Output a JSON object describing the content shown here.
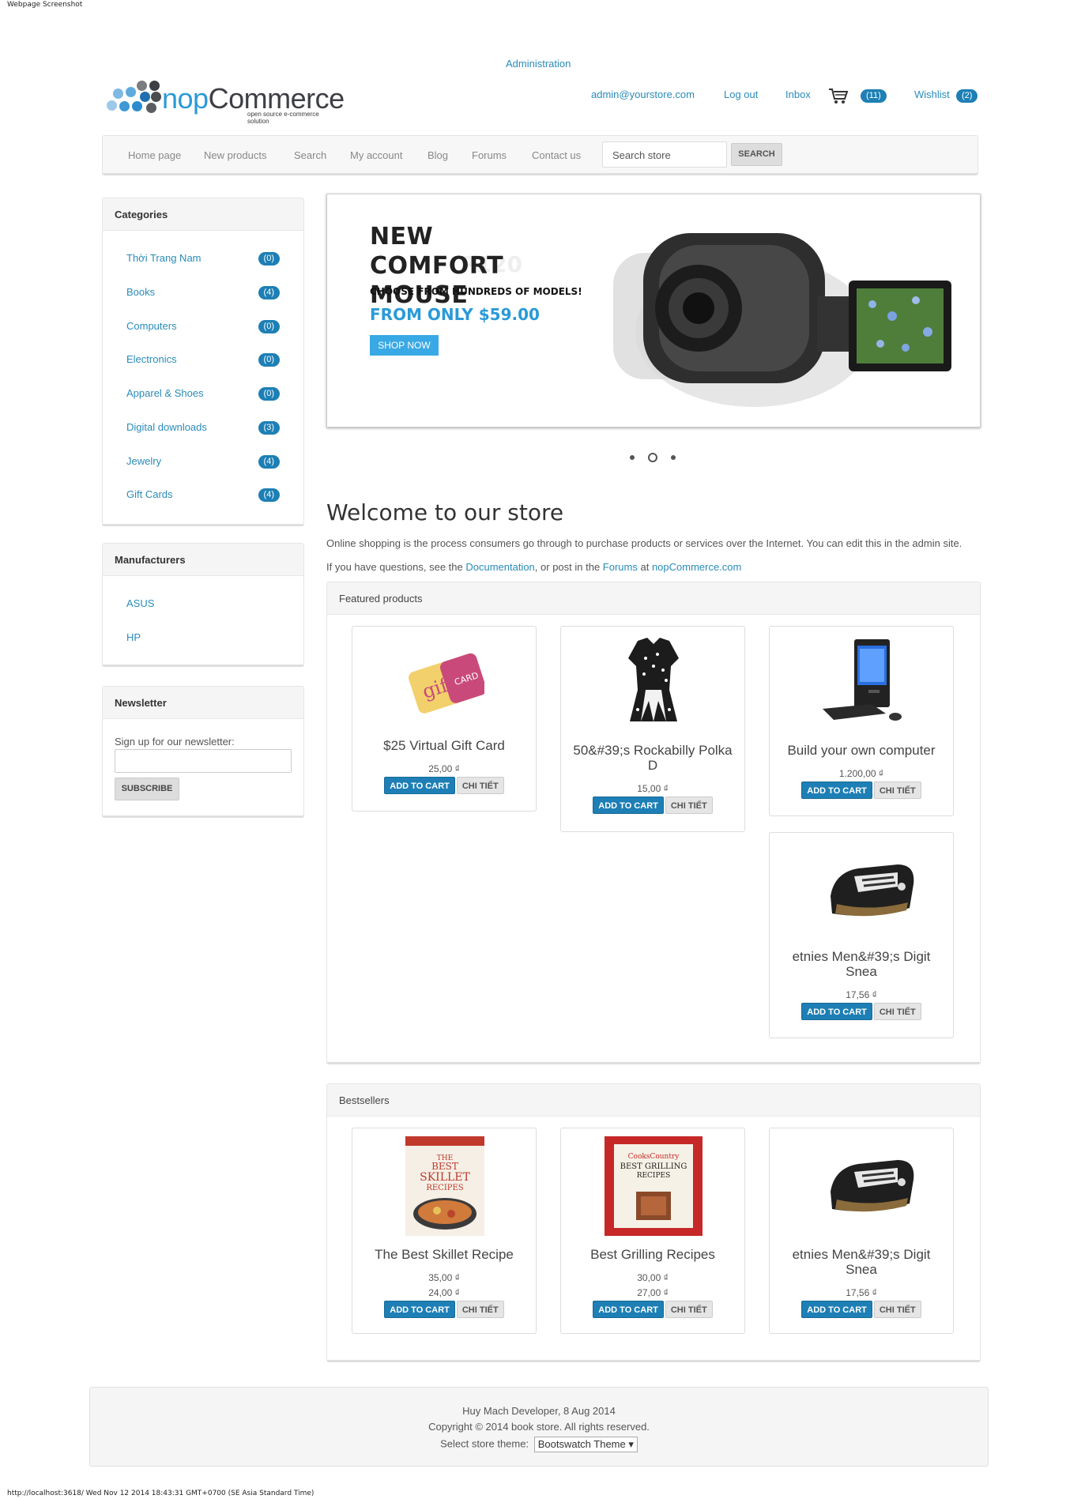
{
  "captions": {
    "top": "Webpage Screenshot",
    "bottom": "http://localhost:3618/ Wed Nov 12 2014 18:43:31 GMT+0700 (SE Asia Standard Time)"
  },
  "header": {
    "admin_link": "Administration",
    "logo_text_a": "nop",
    "logo_text_b": "Commerce",
    "logo_tagline": "open source e-commerce solution",
    "account": "admin@yourstore.com",
    "logout": "Log out",
    "inbox": "Inbox",
    "cart_count": "(11)",
    "wishlist": "Wishlist",
    "wishlist_count": "(2)"
  },
  "nav": {
    "items": [
      "Home page",
      "New products",
      "Search",
      "My account",
      "Blog",
      "Forums",
      "Contact us"
    ],
    "search_placeholder": "Search store",
    "search_button": "SEARCH"
  },
  "categories": {
    "title": "Categories",
    "items": [
      {
        "label": "Thời Trang Nam",
        "count": "(0)"
      },
      {
        "label": "Books",
        "count": "(4)"
      },
      {
        "label": "Computers",
        "count": "(0)"
      },
      {
        "label": "Electronics",
        "count": "(0)"
      },
      {
        "label": "Apparel & Shoes",
        "count": "(0)"
      },
      {
        "label": "Digital downloads",
        "count": "(3)"
      },
      {
        "label": "Jewelry",
        "count": "(4)"
      },
      {
        "label": "Gift Cards",
        "count": "(4)"
      }
    ]
  },
  "manufacturers": {
    "title": "Manufacturers",
    "items": [
      "ASUS",
      "HP"
    ]
  },
  "newsletter": {
    "title": "Newsletter",
    "label": "Sign up for our newsletter:",
    "button": "SUBSCRIBE"
  },
  "slider": {
    "title": "NEW COMFORT MOUSE",
    "ghost": "P120",
    "subtitle": "CHOOSE FROM HUNDREDS OF MODELS!",
    "price": "FROM ONLY $59.00",
    "button": "SHOP NOW",
    "active_dot": 2
  },
  "welcome": {
    "title": "Welcome to our store",
    "intro": "Online shopping is the process consumers go through to purchase products or services over the Internet. You can edit this in the admin site.",
    "questions_a": "If you have questions, see the ",
    "documentation": "Documentation",
    "questions_b": ", or post in the ",
    "forums": "Forums",
    "questions_c": " at ",
    "site": "nopCommerce.com"
  },
  "featured": {
    "title": "Featured products",
    "products": [
      {
        "name": "$25 Virtual Gift Card",
        "price": "25,00 ₫",
        "icon": "gift-card-image"
      },
      {
        "name": "50&#39;s Rockabilly Polka D",
        "price": "15,00 ₫",
        "icon": "polka-dress-image"
      },
      {
        "name": "Build your own computer",
        "price": "1.200,00 ₫",
        "icon": "computer-image"
      },
      {
        "name": "etnies Men&#39;s Digit Snea",
        "price": "17,56 ₫",
        "icon": "sneaker-image"
      }
    ]
  },
  "bestsellers": {
    "title": "Bestsellers",
    "products": [
      {
        "name": "The Best Skillet Recipe",
        "old_price": "35,00 ₫",
        "price": "24,00 ₫",
        "icon": "skillet-book-image"
      },
      {
        "name": "Best Grilling Recipes",
        "old_price": "30,00 ₫",
        "price": "27,00 ₫",
        "icon": "grilling-book-image"
      },
      {
        "name": "etnies Men&#39;s Digit Snea",
        "price": "17,56 ₫",
        "icon": "sneaker-image"
      }
    ]
  },
  "buttons": {
    "add_to_cart": "ADD TO CART",
    "details": "CHI TIẾT"
  },
  "footer": {
    "line1": "Huy Mach Developer, 8 Aug 2014",
    "line2": "Copyright © 2014 book store. All rights reserved.",
    "theme_label": "Select store theme:",
    "theme_value": "Bootswatch Theme"
  },
  "colors": {
    "accent": "#2a8bb8",
    "badge": "#1d7fb5",
    "slide_price": "#2a9ad7"
  }
}
